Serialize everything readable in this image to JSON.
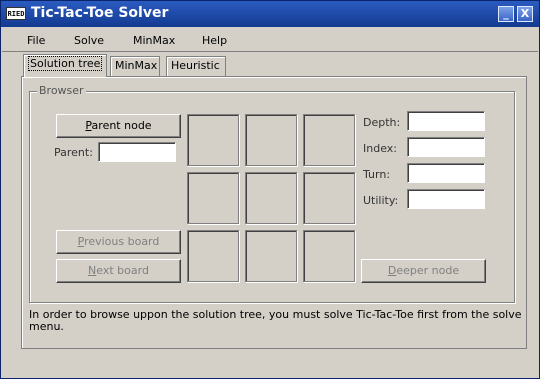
{
  "window": {
    "title": "Tic-Tac-Toe Solver",
    "app_icon_text": "RIED",
    "minimize_glyph": "_",
    "close_glyph": "X"
  },
  "menu": [
    "File",
    "Solve",
    "MinMax",
    "Help"
  ],
  "tabs": [
    {
      "label": "Solution tree",
      "active": true
    },
    {
      "label": "MinMax",
      "active": false
    },
    {
      "label": "Heuristic",
      "active": false
    }
  ],
  "browser": {
    "group_label": "Browser",
    "parent_node_button": {
      "mnemonic": "P",
      "rest": "arent node"
    },
    "parent_label": "Parent:",
    "parent_value": "",
    "previous_board_button": {
      "mnemonic": "P",
      "rest": "revious board"
    },
    "next_board_button": {
      "mnemonic": "N",
      "rest": "ext board"
    },
    "deeper_node_button": {
      "mnemonic": "D",
      "rest": "eeper node"
    },
    "fields": {
      "depth": {
        "label": "Depth:",
        "value": ""
      },
      "index": {
        "label": "Index:",
        "value": ""
      },
      "turn": {
        "label": "Turn:",
        "value": ""
      },
      "utility": {
        "label": "Utility:",
        "value": ""
      }
    },
    "board": [
      "",
      "",
      "",
      "",
      "",
      "",
      "",
      "",
      ""
    ]
  },
  "status": "In order to browse uppon the solution tree, you must solve Tic-Tac-Toe first from the solve menu."
}
